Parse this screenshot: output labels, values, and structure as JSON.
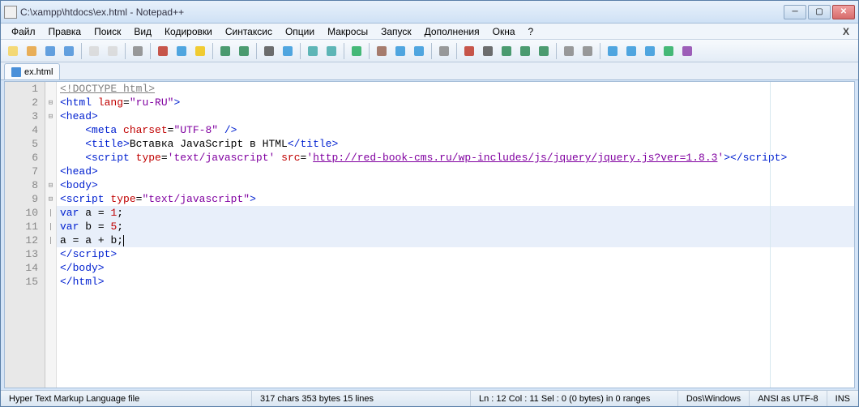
{
  "title": "C:\\xampp\\htdocs\\ex.html - Notepad++",
  "menu": [
    "Файл",
    "Правка",
    "Поиск",
    "Вид",
    "Кодировки",
    "Синтаксис",
    "Опции",
    "Макросы",
    "Запуск",
    "Дополнения",
    "Окна",
    "?"
  ],
  "tab": {
    "label": "ex.html"
  },
  "code": {
    "lines": [
      {
        "n": 1,
        "fold": "",
        "segs": [
          {
            "t": "<!DOCTYPE html>",
            "c": "gray",
            "u": true
          }
        ]
      },
      {
        "n": 2,
        "fold": "⊟",
        "segs": [
          {
            "t": "<html ",
            "c": "blue"
          },
          {
            "t": "lang",
            "c": "red"
          },
          {
            "t": "=",
            "c": "black"
          },
          {
            "t": "\"ru-RU\"",
            "c": "purple"
          },
          {
            "t": ">",
            "c": "blue"
          }
        ]
      },
      {
        "n": 3,
        "fold": "⊟",
        "segs": [
          {
            "t": "<head>",
            "c": "blue"
          }
        ]
      },
      {
        "n": 4,
        "fold": "",
        "indent": 1,
        "segs": [
          {
            "t": "<meta ",
            "c": "blue"
          },
          {
            "t": "charset",
            "c": "red"
          },
          {
            "t": "=",
            "c": "black"
          },
          {
            "t": "\"UTF-8\"",
            "c": "purple"
          },
          {
            "t": " />",
            "c": "blue"
          }
        ]
      },
      {
        "n": 5,
        "fold": "",
        "indent": 1,
        "segs": [
          {
            "t": "<title>",
            "c": "blue"
          },
          {
            "t": "Вставка JavaScript в HTML",
            "c": "black"
          },
          {
            "t": "</title>",
            "c": "blue"
          }
        ]
      },
      {
        "n": 6,
        "fold": "",
        "indent": 1,
        "segs": [
          {
            "t": "<script ",
            "c": "blue"
          },
          {
            "t": "type",
            "c": "red"
          },
          {
            "t": "=",
            "c": "black"
          },
          {
            "t": "'text/javascript'",
            "c": "purple"
          },
          {
            "t": " ",
            "c": "black"
          },
          {
            "t": "src",
            "c": "red"
          },
          {
            "t": "=",
            "c": "black"
          },
          {
            "t": "'",
            "c": "purple"
          },
          {
            "t": "http://red-book-cms.ru/wp-includes/js/jquery/jquery.js?ver=1.8.3",
            "c": "purple",
            "u": true
          },
          {
            "t": "'",
            "c": "purple"
          },
          {
            "t": "></scr",
            "c": "blue"
          },
          {
            "t": "ipt>",
            "c": "blue"
          }
        ]
      },
      {
        "n": 7,
        "fold": "",
        "segs": [
          {
            "t": "<head>",
            "c": "blue"
          }
        ]
      },
      {
        "n": 8,
        "fold": "⊟",
        "segs": [
          {
            "t": "<body>",
            "c": "blue"
          }
        ]
      },
      {
        "n": 9,
        "fold": "⊟",
        "segs": [
          {
            "t": "<script ",
            "c": "blue"
          },
          {
            "t": "type",
            "c": "red"
          },
          {
            "t": "=",
            "c": "black"
          },
          {
            "t": "\"text/javascript\"",
            "c": "purple"
          },
          {
            "t": ">",
            "c": "blue"
          }
        ]
      },
      {
        "n": 10,
        "fold": "|",
        "segs": [
          {
            "t": "var",
            "c": "blue"
          },
          {
            "t": " a ",
            "c": "black"
          },
          {
            "t": "=",
            "c": "black"
          },
          {
            "t": " ",
            "c": "black"
          },
          {
            "t": "1",
            "c": "red"
          },
          {
            "t": ";",
            "c": "black"
          }
        ]
      },
      {
        "n": 11,
        "fold": "|",
        "segs": [
          {
            "t": "var",
            "c": "blue"
          },
          {
            "t": " b ",
            "c": "black"
          },
          {
            "t": "=",
            "c": "black"
          },
          {
            "t": " ",
            "c": "black"
          },
          {
            "t": "5",
            "c": "red"
          },
          {
            "t": ";",
            "c": "black"
          }
        ]
      },
      {
        "n": 12,
        "fold": "|",
        "current": true,
        "segs": [
          {
            "t": "a ",
            "c": "black"
          },
          {
            "t": "=",
            "c": "black"
          },
          {
            "t": " a ",
            "c": "black"
          },
          {
            "t": "+",
            "c": "black"
          },
          {
            "t": " b",
            "c": "black"
          },
          {
            "t": ";",
            "c": "black"
          }
        ]
      },
      {
        "n": 13,
        "fold": "",
        "segs": [
          {
            "t": "</scr",
            "c": "blue"
          },
          {
            "t": "ipt>",
            "c": "blue"
          }
        ]
      },
      {
        "n": 14,
        "fold": "",
        "segs": [
          {
            "t": "</body>",
            "c": "blue"
          }
        ]
      },
      {
        "n": 15,
        "fold": "",
        "segs": [
          {
            "t": "</html>",
            "c": "blue"
          }
        ]
      }
    ]
  },
  "status": {
    "filetype": "Hyper Text Markup Language file",
    "stats": "317 chars   353 bytes   15 lines",
    "pos": "Ln : 12    Col : 11    Sel : 0 (0 bytes) in 0 ranges",
    "eol": "Dos\\Windows",
    "enc": "ANSI as UTF-8",
    "mode": "INS"
  },
  "toolbar_icons": [
    "new-file",
    "open-file",
    "save-file",
    "save-all",
    "sep",
    "close-file",
    "close-all",
    "sep",
    "print",
    "sep",
    "cut",
    "copy",
    "paste",
    "sep",
    "undo",
    "redo",
    "sep",
    "find",
    "replace",
    "sep",
    "zoom-in",
    "zoom-out",
    "sep",
    "sync",
    "sep",
    "wrap",
    "show-all",
    "indent-guide",
    "sep",
    "language",
    "sep",
    "record",
    "stop",
    "play",
    "play-multi",
    "fast-forward",
    "sep",
    "toggle-1",
    "toggle-2",
    "sep",
    "up",
    "down",
    "bookmark",
    "marker",
    "spell-check"
  ],
  "icon_colors": {
    "new-file": "#f4d35e",
    "open-file": "#e8a23c",
    "save-file": "#4a90d9",
    "save-all": "#4a90d9",
    "close-file": "#d8d8d8",
    "close-all": "#d8d8d8",
    "print": "#888",
    "cut": "#c0392b",
    "copy": "#3498db",
    "paste": "#f1c40f",
    "undo": "#2e8b57",
    "redo": "#2e8b57",
    "find": "#555",
    "replace": "#3498db",
    "zoom-in": "#4aa",
    "zoom-out": "#4aa",
    "sync": "#27ae60",
    "wrap": "#965",
    "show-all": "#3498db",
    "indent-guide": "#3498db",
    "language": "#888",
    "record": "#c0392b",
    "stop": "#555",
    "play": "#2e8b57",
    "play-multi": "#2e8b57",
    "fast-forward": "#2e8b57",
    "toggle-1": "#888",
    "toggle-2": "#888",
    "up": "#3498db",
    "down": "#3498db",
    "bookmark": "#3498db",
    "marker": "#27ae60",
    "spell-check": "#8e44ad"
  }
}
